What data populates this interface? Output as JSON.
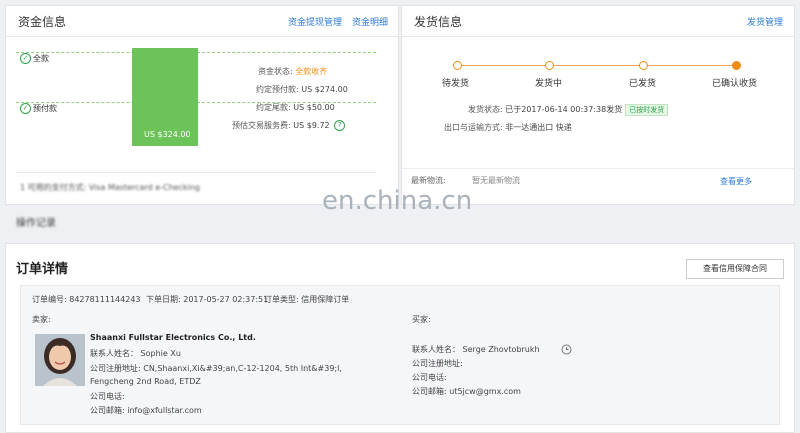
{
  "funds": {
    "title": "资金信息",
    "link_withdraw": "资金提现管理",
    "link_detail": "资金明细",
    "full_payment_label": "全款",
    "advance_label": "预付款",
    "bar_value_label": "US $324.00",
    "status_key": "资金状态:",
    "status_val": "全款收齐",
    "advance_key": "约定预付款:",
    "advance_val": "US $274.00",
    "final_key": "约定尾款:",
    "final_val": "US $50.00",
    "fee_key": "预估交易服务费:",
    "fee_val": "US $9.72",
    "fee_help": "?",
    "footer_text": "1 可用的支付方式: Visa Mastercard e-Checking",
    "record_text": "操作记录"
  },
  "shipping": {
    "title": "发货信息",
    "link_manage": "发货管理",
    "steps": [
      "待发货",
      "发货中",
      "已发货",
      "已确认收货"
    ],
    "status_key": "发货状态:",
    "status_val": "已于2017-06-14 00:37:38发货",
    "status_badge": "已按时发货",
    "method_key": "出口与运输方式:",
    "method_val": "非一达通出口 快递",
    "logistics_key": "最新物流:",
    "logistics_val": "暂无最新物流",
    "see_more": "查看更多"
  },
  "watermark": "en.china.cn",
  "order": {
    "title": "订单详情",
    "credit_button": "查看信用保障合同",
    "order_no": "订单编号: 84278111144243",
    "order_date": "下单日期: 2017-05-27 02:37:51",
    "order_type": "订单类型: 信用保障订单",
    "seller_heading": "卖家:",
    "seller_company": "Shaanxi Fullstar Electronics Co., Ltd.",
    "seller_contact": "联系人姓名： Sophie Xu",
    "seller_addr_1": "公司注册地址: CN,Shaanxi,Xi&#39;an,C-12-1204, 5th Int&#39;l,",
    "seller_addr_2": "Fengcheng 2nd Road, ETDZ",
    "seller_phone": "公司电话:",
    "seller_email": "公司邮箱: info@xfullstar.com",
    "buyer_heading": "买家:",
    "buyer_contact": "联系人姓名： Serge Zhovtobrukh",
    "buyer_addr": "公司注册地址:",
    "buyer_phone": "公司电话:",
    "buyer_email": "公司邮箱: ut5jcw@gmx.com"
  }
}
